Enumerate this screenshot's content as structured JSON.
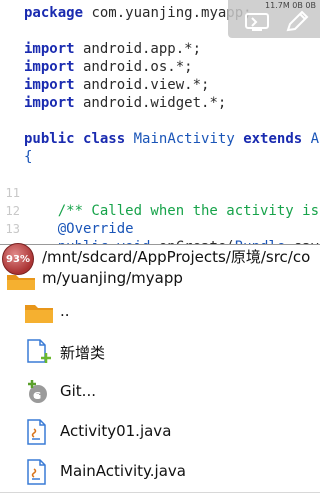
{
  "editor": {
    "lines": [
      {
        "num": "",
        "segments": [
          {
            "t": "package",
            "c": "kw"
          },
          {
            "t": " com.yuanjing.myapp;",
            "c": ""
          }
        ]
      },
      {
        "num": "",
        "segments": []
      },
      {
        "num": "",
        "segments": [
          {
            "t": "import",
            "c": "kw"
          },
          {
            "t": " android.app.*;",
            "c": ""
          }
        ]
      },
      {
        "num": "",
        "segments": [
          {
            "t": "import",
            "c": "kw"
          },
          {
            "t": " android.os.*;",
            "c": ""
          }
        ]
      },
      {
        "num": "",
        "segments": [
          {
            "t": "import",
            "c": "kw"
          },
          {
            "t": " android.view.*;",
            "c": ""
          }
        ]
      },
      {
        "num": "",
        "segments": [
          {
            "t": "import",
            "c": "kw"
          },
          {
            "t": " android.widget.*;",
            "c": ""
          }
        ]
      },
      {
        "num": "",
        "segments": []
      },
      {
        "num": "",
        "segments": [
          {
            "t": "public",
            "c": "kw"
          },
          {
            "t": " ",
            "c": ""
          },
          {
            "t": "class",
            "c": "kw"
          },
          {
            "t": " ",
            "c": ""
          },
          {
            "t": "MainActivity",
            "c": "type"
          },
          {
            "t": " ",
            "c": ""
          },
          {
            "t": "extends",
            "c": "kw"
          },
          {
            "t": " Act",
            "c": "type"
          }
        ]
      },
      {
        "num": "",
        "segments": [
          {
            "t": "{",
            "c": "type"
          }
        ]
      },
      {
        "num": "",
        "segments": []
      },
      {
        "num": "11",
        "segments": []
      },
      {
        "num": "12",
        "segments": [
          {
            "t": "    ",
            "c": ""
          },
          {
            "t": "/** Called when the activity is f",
            "c": "comment"
          }
        ]
      },
      {
        "num": "13",
        "segments": [
          {
            "t": "    ",
            "c": ""
          },
          {
            "t": "@Override",
            "c": "annot"
          }
        ]
      },
      {
        "num": "",
        "segments": [
          {
            "t": "    ",
            "c": ""
          },
          {
            "t": "public",
            "c": "type"
          },
          {
            "t": " ",
            "c": ""
          },
          {
            "t": "void",
            "c": "type"
          },
          {
            "t": " onCreate(",
            "c": ""
          },
          {
            "t": "Bundle",
            "c": "type"
          },
          {
            "t": " saved",
            "c": ""
          }
        ]
      }
    ]
  },
  "status": {
    "text": "11.7M 0B 0B",
    "icons": [
      "screen-icon",
      "pencil-icon"
    ]
  },
  "browser": {
    "percent": "93%",
    "path": "/mnt/sdcard/AppProjects/原境/src/com/yuanjing/myapp",
    "items": [
      {
        "label": "..",
        "icon": "folder-icon"
      },
      {
        "label": "新增类",
        "icon": "new-file-icon"
      },
      {
        "label": "Git...",
        "icon": "git-icon"
      },
      {
        "label": "Activity01.java",
        "icon": "java-file-icon"
      },
      {
        "label": "MainActivity.java",
        "icon": "java-file-icon"
      }
    ]
  },
  "colors": {
    "keyword": "#1a2bb0",
    "comment": "#17a34a",
    "type": "#1a55b8",
    "folder": "#f0a020",
    "badge": "#a33333"
  }
}
